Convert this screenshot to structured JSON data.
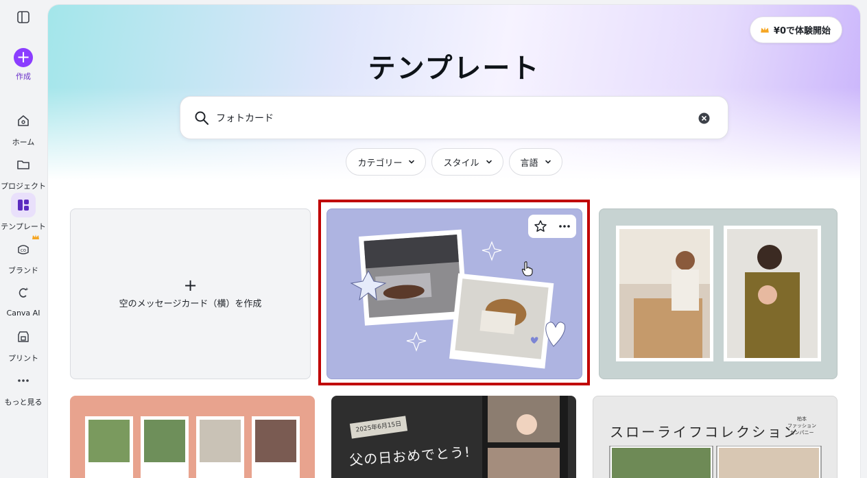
{
  "sidebar": {
    "create_label": "作成",
    "items": [
      {
        "label": "ホーム",
        "icon": "home-icon"
      },
      {
        "label": "プロジェクト",
        "icon": "folder-icon"
      },
      {
        "label": "テンプレート",
        "icon": "template-icon",
        "active": true
      },
      {
        "label": "ブランド",
        "icon": "brand-icon",
        "premium": true
      },
      {
        "label": "Canva AI",
        "icon": "canva-ai-icon"
      },
      {
        "label": "プリント",
        "icon": "print-icon"
      },
      {
        "label": "もっと見る",
        "icon": "more-icon"
      }
    ]
  },
  "header": {
    "trial_label": "¥0で体験開始",
    "title": "テンプレート"
  },
  "search": {
    "value": "フォトカード",
    "placeholder": ""
  },
  "filters": [
    {
      "label": "カテゴリー"
    },
    {
      "label": "スタイル"
    },
    {
      "label": "言語"
    }
  ],
  "cards": {
    "blank_label": "空のメッセージカード（横）を作成",
    "chalk_date": "2025年6月15日",
    "chalk_text": "父の日おめでとう!",
    "slow_title": "スローライフコレクション",
    "slow_side_1": "柏本",
    "slow_side_2": "ファッション",
    "slow_side_3": "カンパニー"
  },
  "colors": {
    "accent": "#8b3dff",
    "highlight": "#c00000",
    "card_main_bg": "#aeb4e1"
  }
}
